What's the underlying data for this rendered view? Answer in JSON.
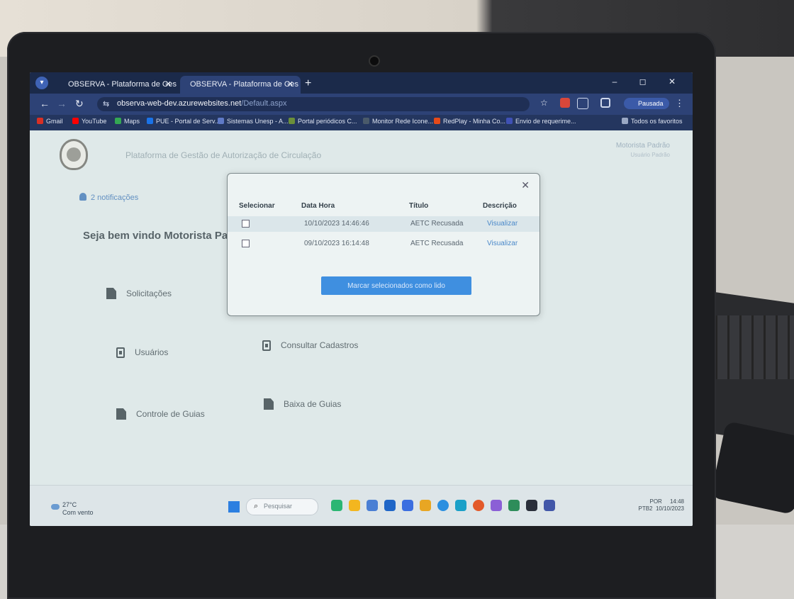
{
  "browser": {
    "tabs": [
      {
        "label": "OBSERVA - Plataforma de Ges",
        "active": false
      },
      {
        "label": "OBSERVA - Plataforma de Ges",
        "active": true
      }
    ],
    "url_host": "observa-web-dev.azurewebsites.net",
    "url_path": "/Default.aspx",
    "paused_label": "Pausada",
    "bookmarks": [
      {
        "label": "Gmail",
        "color": "#d93025"
      },
      {
        "label": "YouTube",
        "color": "#ff0000"
      },
      {
        "label": "Maps",
        "color": "#34a853"
      },
      {
        "label": "PUE - Portal de Serv...",
        "color": "#1a73e8"
      },
      {
        "label": "Sistemas Unesp - A...",
        "color": "#5f7ac7"
      },
      {
        "label": "Portal periódicos C...",
        "color": "#6b8f3a"
      },
      {
        "label": "Monitor Rede Icone...",
        "color": "#4a5a6a"
      },
      {
        "label": "RedPlay - Minha Co...",
        "color": "#e64a19"
      },
      {
        "label": "Envio de requerime...",
        "color": "#3f51b5"
      },
      {
        "label": "Todos os favoritos",
        "color": "#9aa8c4"
      }
    ]
  },
  "header": {
    "platform_title": "Plataforma de Gestão de Autorização de Circulação",
    "user_name": "Motorista Padrão",
    "user_role": "Usuário Padrão"
  },
  "notifications_label": "2 notificações",
  "welcome_text": "Seja bem vindo Motorista Padrã",
  "menu": {
    "solicitacoes": "Solicitações",
    "usuarios": "Usuários",
    "consultar_cadastros": "Consultar Cadastros",
    "controle_guias": "Controle de Guias",
    "baixa_guias": "Baixa de Guias"
  },
  "modal": {
    "columns": {
      "select": "Selecionar",
      "datetime": "Data Hora",
      "title": "Título",
      "description": "Descrição"
    },
    "rows": [
      {
        "datetime": "10/10/2023 14:46:46",
        "title": "AETC Recusada",
        "description": "Visualizar"
      },
      {
        "datetime": "09/10/2023 16:14:48",
        "title": "AETC Recusada",
        "description": "Visualizar"
      }
    ],
    "mark_button": "Marcar selecionados como lido"
  },
  "taskbar": {
    "weather_temp": "27°C",
    "weather_desc": "Com vento",
    "search_placeholder": "Pesquisar",
    "lang": "POR",
    "lang_sub": "PTB2",
    "time": "14:48",
    "date": "10/10/2023"
  }
}
